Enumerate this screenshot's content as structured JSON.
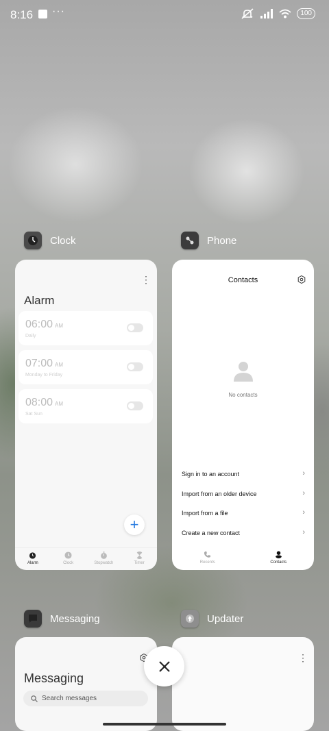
{
  "status_bar": {
    "time": "8:16",
    "more": "···",
    "battery": "100"
  },
  "apps": {
    "clock": {
      "name": "Clock",
      "screen_title": "Alarm",
      "alarms": [
        {
          "time": "06:00",
          "ampm": "AM",
          "repeat": "Daily",
          "enabled": false
        },
        {
          "time": "07:00",
          "ampm": "AM",
          "repeat": "Monday to Friday",
          "enabled": false
        },
        {
          "time": "08:00",
          "ampm": "AM",
          "repeat": "Sat Sun",
          "enabled": false
        }
      ],
      "fab": "+",
      "nav": [
        {
          "label": "Alarm",
          "icon": "alarm-icon",
          "active": true
        },
        {
          "label": "Clock",
          "icon": "clock-icon",
          "active": false
        },
        {
          "label": "Stopwatch",
          "icon": "stopwatch-icon",
          "active": false
        },
        {
          "label": "Timer",
          "icon": "hourglass-icon",
          "active": false
        }
      ]
    },
    "phone": {
      "name": "Phone",
      "screen_title": "Contacts",
      "empty_text": "No contacts",
      "actions": [
        "Sign in to an account",
        "Import from an older device",
        "Import from a file",
        "Create a new contact"
      ],
      "nav": [
        {
          "label": "Recents",
          "icon": "phone-icon",
          "active": false
        },
        {
          "label": "Contacts",
          "icon": "person-icon",
          "active": true
        }
      ]
    },
    "messaging": {
      "name": "Messaging",
      "screen_title": "Messaging",
      "search_placeholder": "Search messages"
    },
    "updater": {
      "name": "Updater"
    }
  },
  "colors": {
    "accent": "#2a7de1",
    "card_bg": "#f7f7f7"
  }
}
